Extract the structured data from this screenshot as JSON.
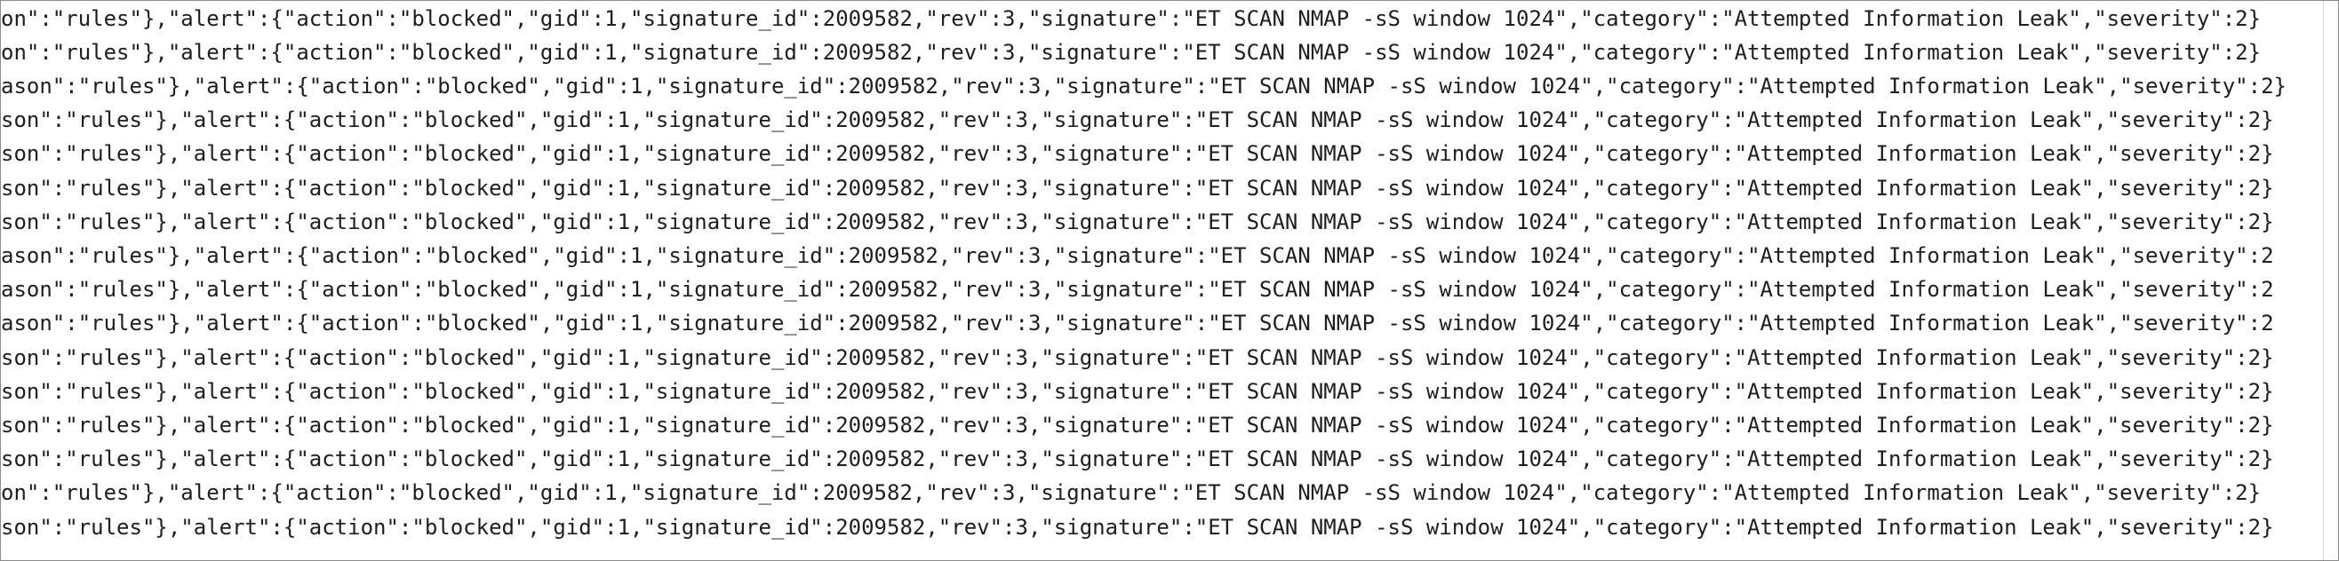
{
  "log": {
    "lines": [
      "on\":\"rules\"},\"alert\":{\"action\":\"blocked\",\"gid\":1,\"signature_id\":2009582,\"rev\":3,\"signature\":\"ET SCAN NMAP -sS window 1024\",\"category\":\"Attempted Information Leak\",\"severity\":2}",
      "on\":\"rules\"},\"alert\":{\"action\":\"blocked\",\"gid\":1,\"signature_id\":2009582,\"rev\":3,\"signature\":\"ET SCAN NMAP -sS window 1024\",\"category\":\"Attempted Information Leak\",\"severity\":2}",
      "ason\":\"rules\"},\"alert\":{\"action\":\"blocked\",\"gid\":1,\"signature_id\":2009582,\"rev\":3,\"signature\":\"ET SCAN NMAP -sS window 1024\",\"category\":\"Attempted Information Leak\",\"severity\":2}",
      "son\":\"rules\"},\"alert\":{\"action\":\"blocked\",\"gid\":1,\"signature_id\":2009582,\"rev\":3,\"signature\":\"ET SCAN NMAP -sS window 1024\",\"category\":\"Attempted Information Leak\",\"severity\":2}",
      "son\":\"rules\"},\"alert\":{\"action\":\"blocked\",\"gid\":1,\"signature_id\":2009582,\"rev\":3,\"signature\":\"ET SCAN NMAP -sS window 1024\",\"category\":\"Attempted Information Leak\",\"severity\":2}",
      "son\":\"rules\"},\"alert\":{\"action\":\"blocked\",\"gid\":1,\"signature_id\":2009582,\"rev\":3,\"signature\":\"ET SCAN NMAP -sS window 1024\",\"category\":\"Attempted Information Leak\",\"severity\":2}",
      "son\":\"rules\"},\"alert\":{\"action\":\"blocked\",\"gid\":1,\"signature_id\":2009582,\"rev\":3,\"signature\":\"ET SCAN NMAP -sS window 1024\",\"category\":\"Attempted Information Leak\",\"severity\":2}",
      "ason\":\"rules\"},\"alert\":{\"action\":\"blocked\",\"gid\":1,\"signature_id\":2009582,\"rev\":3,\"signature\":\"ET SCAN NMAP -sS window 1024\",\"category\":\"Attempted Information Leak\",\"severity\":2",
      "ason\":\"rules\"},\"alert\":{\"action\":\"blocked\",\"gid\":1,\"signature_id\":2009582,\"rev\":3,\"signature\":\"ET SCAN NMAP -sS window 1024\",\"category\":\"Attempted Information Leak\",\"severity\":2",
      "ason\":\"rules\"},\"alert\":{\"action\":\"blocked\",\"gid\":1,\"signature_id\":2009582,\"rev\":3,\"signature\":\"ET SCAN NMAP -sS window 1024\",\"category\":\"Attempted Information Leak\",\"severity\":2",
      "son\":\"rules\"},\"alert\":{\"action\":\"blocked\",\"gid\":1,\"signature_id\":2009582,\"rev\":3,\"signature\":\"ET SCAN NMAP -sS window 1024\",\"category\":\"Attempted Information Leak\",\"severity\":2}",
      "son\":\"rules\"},\"alert\":{\"action\":\"blocked\",\"gid\":1,\"signature_id\":2009582,\"rev\":3,\"signature\":\"ET SCAN NMAP -sS window 1024\",\"category\":\"Attempted Information Leak\",\"severity\":2}",
      "son\":\"rules\"},\"alert\":{\"action\":\"blocked\",\"gid\":1,\"signature_id\":2009582,\"rev\":3,\"signature\":\"ET SCAN NMAP -sS window 1024\",\"category\":\"Attempted Information Leak\",\"severity\":2}",
      "son\":\"rules\"},\"alert\":{\"action\":\"blocked\",\"gid\":1,\"signature_id\":2009582,\"rev\":3,\"signature\":\"ET SCAN NMAP -sS window 1024\",\"category\":\"Attempted Information Leak\",\"severity\":2}",
      "on\":\"rules\"},\"alert\":{\"action\":\"blocked\",\"gid\":1,\"signature_id\":2009582,\"rev\":3,\"signature\":\"ET SCAN NMAP -sS window 1024\",\"category\":\"Attempted Information Leak\",\"severity\":2}",
      "son\":\"rules\"},\"alert\":{\"action\":\"blocked\",\"gid\":1,\"signature_id\":2009582,\"rev\":3,\"signature\":\"ET SCAN NMAP -sS window 1024\",\"category\":\"Attempted Information Leak\",\"severity\":2}"
    ]
  }
}
